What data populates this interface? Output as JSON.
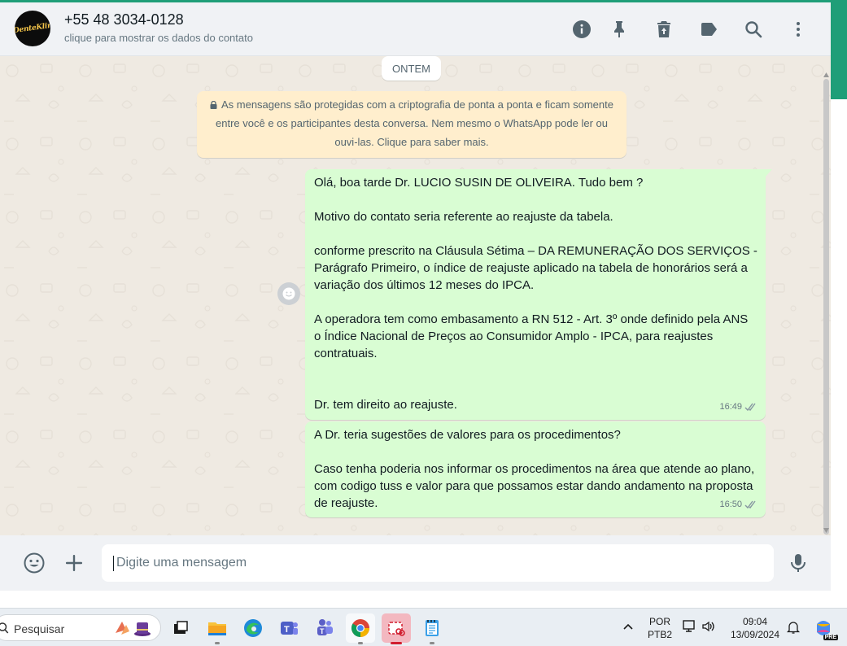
{
  "header": {
    "avatar_text": "DenteKlin",
    "contact_name": "+55 48 3034-0128",
    "contact_subtitle": "clique para mostrar os dados do contato",
    "icons": [
      "info-icon",
      "pin-icon",
      "delete-icon",
      "label-icon",
      "search-icon",
      "menu-icon"
    ]
  },
  "chat": {
    "date_chip": "ONTEM",
    "encryption_notice": "As mensagens são protegidas com a criptografia de ponta a ponta e ficam somente entre você e os participantes desta conversa. Nem mesmo o WhatsApp pode ler ou ouvi-las. Clique para saber mais.",
    "messages": [
      {
        "text": "Olá, boa tarde Dr. LUCIO SUSIN DE OLIVEIRA. Tudo bem ?\n\nMotivo do contato seria referente ao reajuste da tabela.\n\nconforme prescrito na Cláusula Sétima – DA REMUNERAÇÃO DOS SERVIÇOS - Parágrafo Primeiro, o índice de reajuste aplicado na tabela de honorários será a variação dos últimos 12 meses do IPCA.\n\nA operadora tem como embasamento a RN 512 - Art. 3º onde definido pela ANS o Índice Nacional de Preços ao Consumidor Amplo - IPCA, para reajustes contratuais.\n\n\nDr. tem direito ao reajuste.",
        "time": "16:49",
        "status": "read"
      },
      {
        "text": "A Dr. teria sugestões de valores para os procedimentos?\n\nCaso tenha poderia nos informar os procedimentos na área que atende ao plano, com codigo tuss e valor para que possamos estar dando andamento na proposta de reajuste.",
        "time": "16:50",
        "status": "read"
      }
    ]
  },
  "composer": {
    "placeholder": "Digite uma mensagem"
  },
  "taskbar": {
    "search_label": "Pesquisar",
    "language_line1": "POR",
    "language_line2": "PTB2",
    "clock_time": "09:04",
    "clock_date": "13/09/2024",
    "copilot_badge": "PRE"
  },
  "colors": {
    "outgoing_bubble": "#d9fdd3",
    "notice_bg": "#ffeecd",
    "chat_bg": "#efeae2",
    "header_bg": "#f0f2f5",
    "accent": "#1f9e78"
  }
}
